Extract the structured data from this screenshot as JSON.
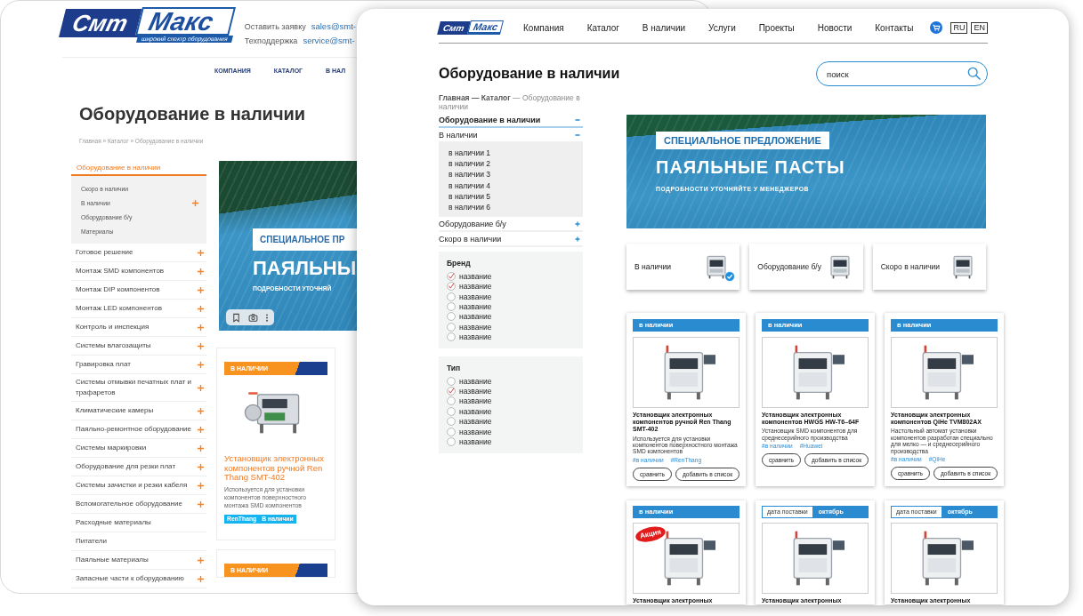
{
  "back_window": {
    "logo": {
      "left": "Смт",
      "right": "Макс",
      "tagline": "широкий спектр оборудования"
    },
    "contacts": [
      {
        "label": "Оставить заявку",
        "email": "sales@smt-"
      },
      {
        "label": "Техподдержка",
        "email": "service@smt-"
      }
    ],
    "nav": [
      "КОМПАНИЯ",
      "КАТАЛОГ",
      "В НАЛ"
    ],
    "title": "Оборудование в наличии",
    "breadcrumb": "Главная » Каталог » Оборудование в наличии",
    "sidebar": {
      "header": "Оборудование в наличии",
      "submenu": [
        {
          "label": "Скоро в наличии",
          "expandable": false
        },
        {
          "label": "В наличии",
          "expandable": true
        },
        {
          "label": "Оборудование б/у",
          "expandable": false
        },
        {
          "label": "Материалы",
          "expandable": false
        }
      ],
      "items": [
        {
          "label": "Готовое решение",
          "expandable": true
        },
        {
          "label": "Монтаж SMD компонентов",
          "expandable": true
        },
        {
          "label": "Монтаж DIP компонентов",
          "expandable": true
        },
        {
          "label": "Монтаж LED компонентов",
          "expandable": true
        },
        {
          "label": "Контроль и инспекция",
          "expandable": true
        },
        {
          "label": "Системы влагозащиты",
          "expandable": true
        },
        {
          "label": "Гравировка плат",
          "expandable": true
        },
        {
          "label": "Системы отмывки печатных плат и трафаретов",
          "expandable": true
        },
        {
          "label": "Климатические камеры",
          "expandable": true
        },
        {
          "label": "Паяльно-ремонтное оборудование",
          "expandable": true
        },
        {
          "label": "Системы маркировки",
          "expandable": true
        },
        {
          "label": "Оборудование для резки плат",
          "expandable": true
        },
        {
          "label": "Системы зачистки и резки кабеля",
          "expandable": true
        },
        {
          "label": "Вспомогательное оборудование",
          "expandable": true
        },
        {
          "label": "Расходные материалы",
          "expandable": false
        },
        {
          "label": "Питатели",
          "expandable": false
        },
        {
          "label": "Паяльные материалы",
          "expandable": true
        },
        {
          "label": "Запасные части к оборудованию",
          "expandable": true
        }
      ]
    },
    "banner": {
      "badge": "СПЕЦИАЛЬНОЕ ПР",
      "headline": "ПАЯЛЬНЫ",
      "note": "ПОДРОБНОСТИ УТОЧНЯЙ"
    },
    "products": [
      {
        "status": {
          "kind": "in_stock",
          "label": "В НАЛИЧИИ"
        },
        "title": "Установщик электронных компонентов ручной Ren Thang SMT-402",
        "description": "Используется для установки компонентов поверхностного монтажа SMD компонентов",
        "tags": [
          "RenThang",
          "В наличии"
        ]
      },
      {
        "status": {
          "kind": "in_stock",
          "label": "В НАЛИЧИИ"
        }
      }
    ]
  },
  "front_window": {
    "logo": {
      "left": "Смт",
      "right": "Макс"
    },
    "nav": [
      "Компания",
      "Каталог",
      "В наличии",
      "Услуги",
      "Проекты",
      "Новости",
      "Контакты"
    ],
    "languages": [
      "RU",
      "EN"
    ],
    "title": "Оборудование в наличии",
    "search": {
      "placeholder": "поиск"
    },
    "breadcrumb": "**Главная — Каталог** — Оборудование в наличии",
    "sidebar": [
      {
        "label": "Оборудование в наличии",
        "kind": "heading",
        "expanded": true
      },
      {
        "label": "В наличии",
        "kind": "section",
        "expanded": true,
        "children": [
          {
            "label": "в наличии 1"
          },
          {
            "label": "в наличии 2"
          },
          {
            "label": "в наличии 3"
          },
          {
            "label": "в наличии 4"
          },
          {
            "label": "в наличии 5"
          },
          {
            "label": "в наличии 6"
          }
        ]
      },
      {
        "label": "Оборудование б/у",
        "kind": "section",
        "expanded": false
      },
      {
        "label": "Скоро в наличии",
        "kind": "section",
        "expanded": false
      }
    ],
    "filters": [
      {
        "title": "Бренд",
        "options": [
          {
            "label": "название",
            "checked": true
          },
          {
            "label": "название",
            "checked": true
          },
          {
            "label": "название",
            "checked": false
          },
          {
            "label": "название",
            "checked": false
          },
          {
            "label": "название",
            "checked": false
          },
          {
            "label": "название",
            "checked": false
          },
          {
            "label": "название",
            "checked": false
          }
        ]
      },
      {
        "title": "Тип",
        "options": [
          {
            "label": "название",
            "checked": false
          },
          {
            "label": "название",
            "checked": true
          },
          {
            "label": "название",
            "checked": false
          },
          {
            "label": "название",
            "checked": false
          },
          {
            "label": "название",
            "checked": false
          },
          {
            "label": "название",
            "checked": false
          },
          {
            "label": "название",
            "checked": false
          }
        ]
      }
    ],
    "banner": {
      "badge": "СПЕЦИАЛЬНОЕ ПРЕДЛОЖЕНИЕ",
      "headline": "ПАЯЛЬНЫЕ ПАСТЫ",
      "note": "ПОДРОБНОСТИ УТОЧНЯЙТЕ У МЕНЕДЖЕРОВ"
    },
    "categories": [
      {
        "label": "В наличии",
        "selected": true
      },
      {
        "label": "Оборудование б/у",
        "selected": false
      },
      {
        "label": "Скоро в наличии",
        "selected": false
      }
    ],
    "products": [
      {
        "status": {
          "kind": "in_stock",
          "label": "в наличии"
        },
        "title": "Установщик электронных компонентов ручной Ren Thang SMT-402",
        "description": "Используется для установки компонентов поверхностного монтажа SMD компонентов",
        "tags": [
          "#в наличии",
          "#RenThang"
        ],
        "actions": [
          "сравнить",
          "добавить в список"
        ]
      },
      {
        "status": {
          "kind": "in_stock",
          "label": "в наличии"
        },
        "title": "Установщик электронных компонентов HWGS HW-T6–64F",
        "description": "Установщик SMD компонентов для среднесерийного производства",
        "tags": [
          "#в наличии",
          "#Huawei"
        ],
        "actions": [
          "сравнить",
          "добавить в список"
        ]
      },
      {
        "status": {
          "kind": "in_stock",
          "label": "в наличии"
        },
        "title": "Установщик электронных компонентов QiHe TVM802AX",
        "description": "Настольный автомат установки компонентов разработан специально для мелко — и среднесерийного производства",
        "tags": [
          "#в наличии",
          "#QiHe"
        ],
        "actions": [
          "сравнить",
          "добавить в список"
        ]
      },
      {
        "status": {
          "kind": "in_stock",
          "label": "в наличии"
        },
        "promo": "Акция",
        "title": "Установщик электронных"
      },
      {
        "status": {
          "kind": "delivery",
          "label": "дата поставки",
          "value": "октябрь"
        },
        "title": "Установщик электронных"
      },
      {
        "status": {
          "kind": "delivery",
          "label": "дата поставки",
          "value": "октябрь"
        },
        "title": "Установщик электронных"
      }
    ]
  }
}
